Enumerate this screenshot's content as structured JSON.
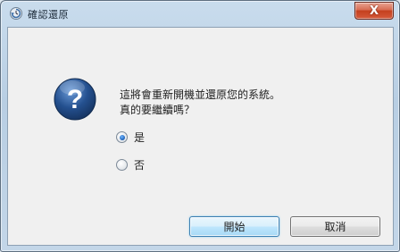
{
  "window": {
    "title": "確認還原"
  },
  "controls": {
    "close_glyph": "X"
  },
  "dialog": {
    "message_line1": "這將會重新開機並還原您的系統。",
    "message_line2": "真的要繼續嗎？",
    "options": [
      {
        "label": "是",
        "selected": true
      },
      {
        "label": "否",
        "selected": false
      }
    ]
  },
  "buttons": {
    "start": "開始",
    "cancel": "取消"
  },
  "colors": {
    "accent": "#3c7fb1",
    "icon": "#1f4a8a",
    "close": "#c4401f"
  }
}
